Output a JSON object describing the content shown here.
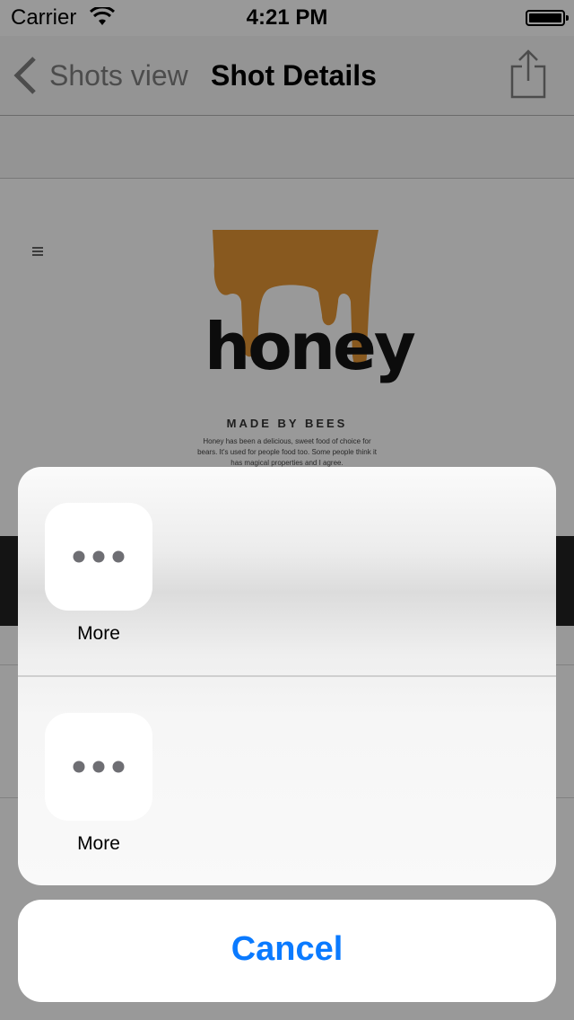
{
  "status_bar": {
    "carrier": "Carrier",
    "time": "4:21 PM"
  },
  "nav_bar": {
    "back_label": "Shots view",
    "title": "Shot Details"
  },
  "shot": {
    "headline": "honey",
    "tagline": "MADE BY BEES",
    "body": "Honey has been a delicious, sweet food of choice for bears. It's used for people food too. Some people think it has magical properties and I agree."
  },
  "action_sheet": {
    "rows": [
      {
        "label": "More",
        "icon": "more-icon"
      },
      {
        "label": "More",
        "icon": "more-icon"
      }
    ],
    "cancel_label": "Cancel"
  },
  "colors": {
    "accent": "#0a7aff",
    "dim": "rgba(0,0,0,0.40)"
  }
}
